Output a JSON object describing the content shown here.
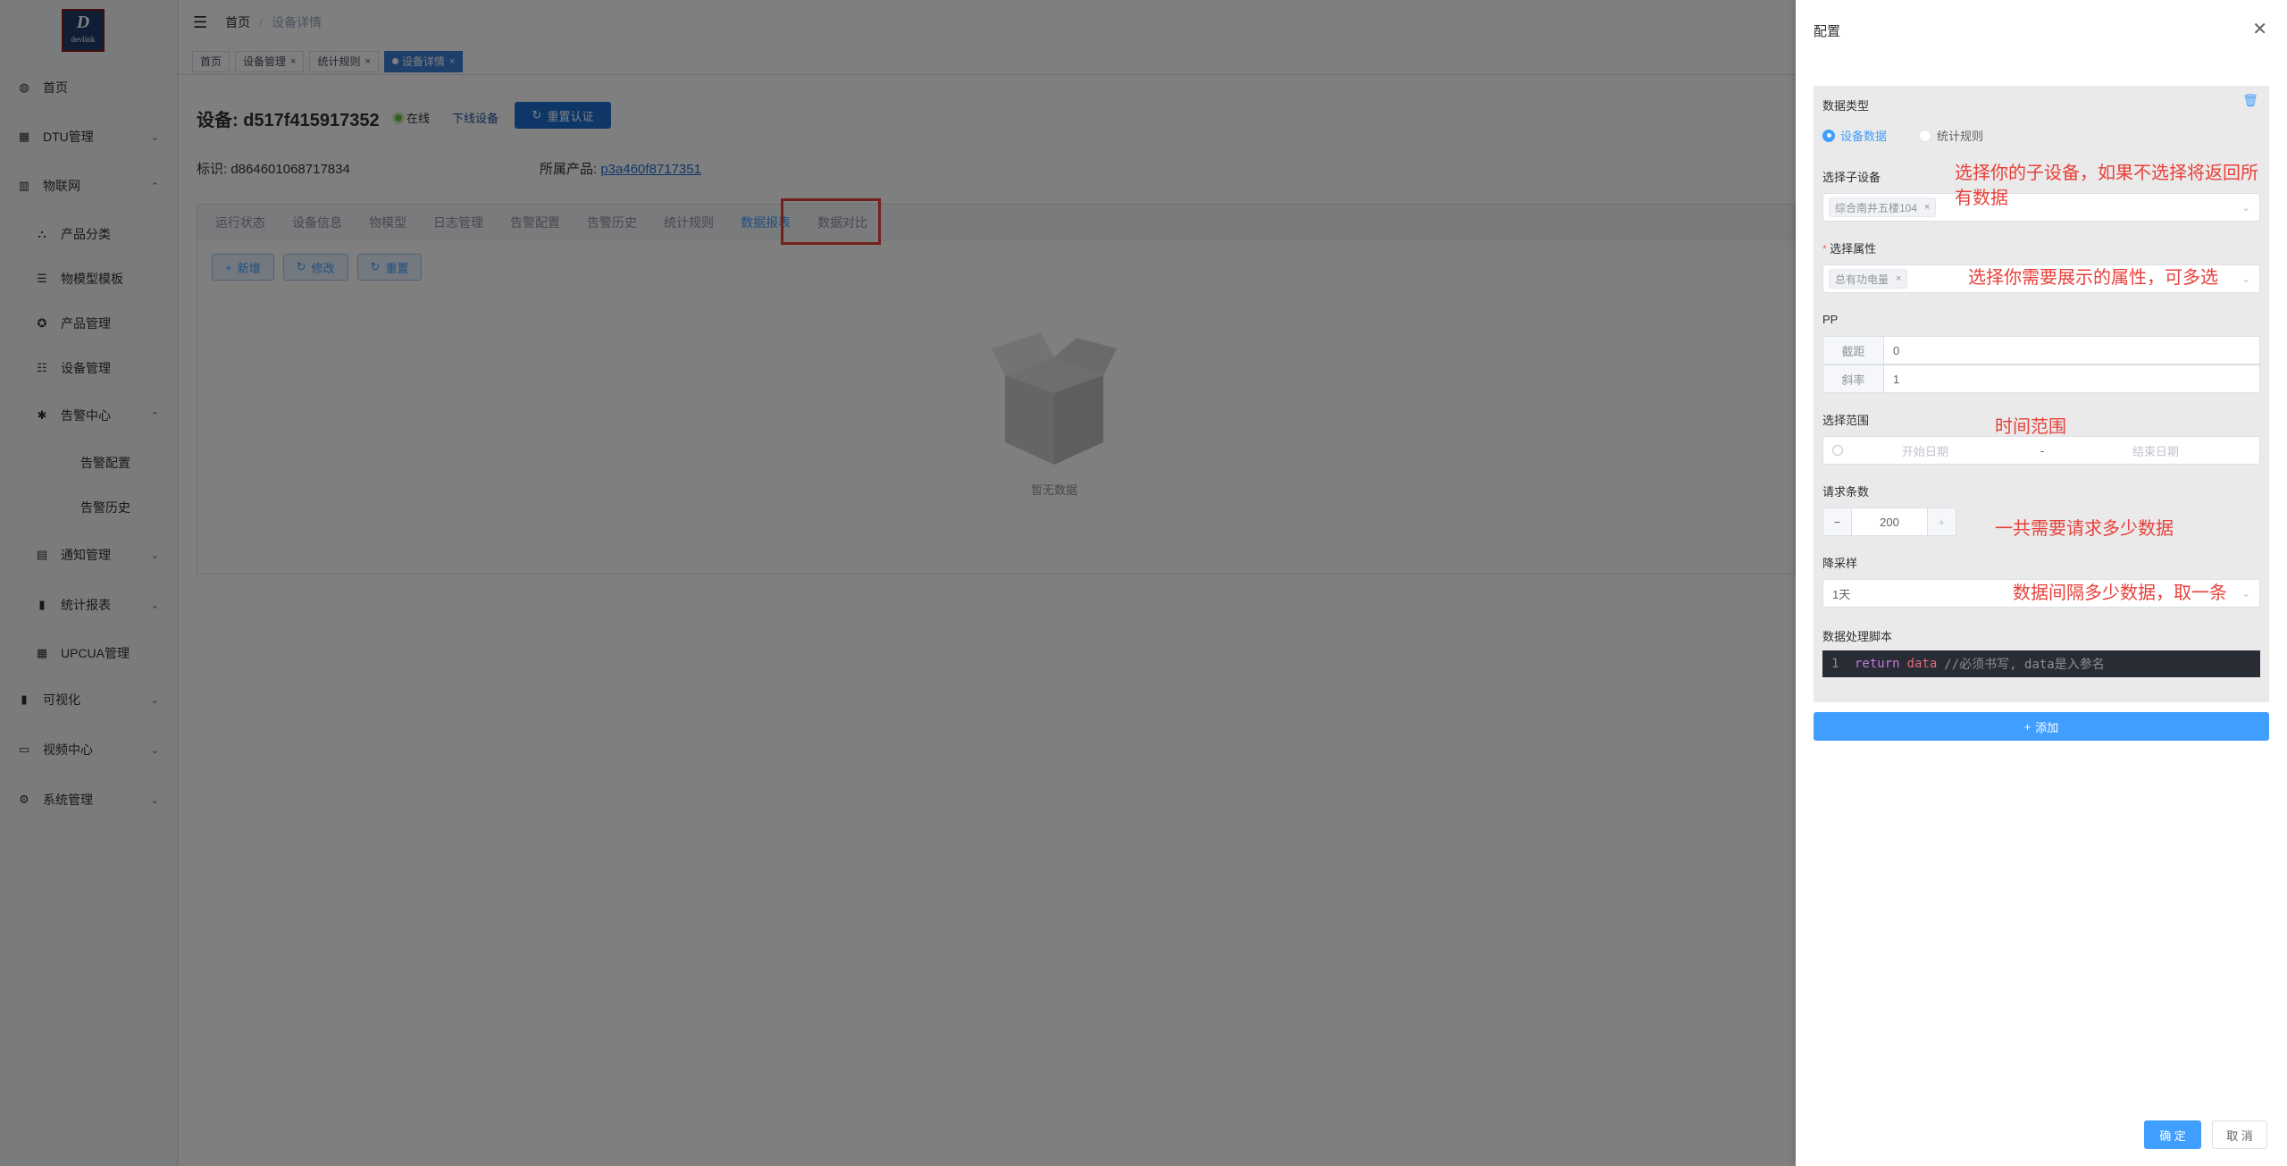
{
  "logo": {
    "letter": "D",
    "text": "devlink"
  },
  "sidebar": {
    "items": [
      {
        "label": "首页",
        "icon": "dashboard-icon",
        "arrow": ""
      },
      {
        "label": "DTU管理",
        "icon": "dtu-icon",
        "arrow": "⌄"
      },
      {
        "label": "物联网",
        "icon": "grid-icon",
        "arrow": "⌃"
      },
      {
        "label": "产品分类",
        "icon": "tree-icon",
        "arrow": ""
      },
      {
        "label": "物模型模板",
        "icon": "list-icon",
        "arrow": ""
      },
      {
        "label": "产品管理",
        "icon": "product-icon",
        "arrow": ""
      },
      {
        "label": "设备管理",
        "icon": "sliders-icon",
        "arrow": ""
      },
      {
        "label": "告警中心",
        "icon": "bug-icon",
        "arrow": "⌃"
      },
      {
        "label": "告警配置",
        "icon": "",
        "arrow": ""
      },
      {
        "label": "告警历史",
        "icon": "",
        "arrow": ""
      },
      {
        "label": "通知管理",
        "icon": "message-icon",
        "arrow": "⌄"
      },
      {
        "label": "统计报表",
        "icon": "chart-icon",
        "arrow": "⌄"
      },
      {
        "label": "UPCUA管理",
        "icon": "dtu-icon",
        "arrow": ""
      },
      {
        "label": "可视化",
        "icon": "chart-icon",
        "arrow": "⌄"
      },
      {
        "label": "视频中心",
        "icon": "monitor-icon",
        "arrow": "⌄"
      },
      {
        "label": "系统管理",
        "icon": "gear-icon",
        "arrow": "⌄"
      }
    ]
  },
  "header": {
    "home": "首页",
    "sep": "/",
    "current": "设备详情"
  },
  "tags": [
    {
      "label": "首页",
      "closable": false,
      "active": false
    },
    {
      "label": "设备管理",
      "closable": true,
      "active": false
    },
    {
      "label": "统计规则",
      "closable": true,
      "active": false
    },
    {
      "label": "设备详情",
      "closable": true,
      "active": true
    }
  ],
  "device": {
    "title": "设备: d517f415917352",
    "status": "在线",
    "offline_link": "下线设备",
    "auth_button": "重置认证",
    "id_label": "标识: d864601068717834",
    "product_label": "所属产品: ",
    "product_link": "p3a460f8717351"
  },
  "tabs": [
    "运行状态",
    "设备信息",
    "物模型",
    "日志管理",
    "告警配置",
    "告警历史",
    "统计规则",
    "数据报表",
    "数据对比"
  ],
  "active_tab": 7,
  "actions": {
    "add": "新增",
    "edit": "修改",
    "reset": "重置"
  },
  "empty_text": "暂无数据",
  "drawer": {
    "title": "配置",
    "data_type_label": "数据类型",
    "radio_device": "设备数据",
    "radio_rule": "统计规则",
    "subdevice_label": "选择子设备",
    "subdevice_chip": "综合南井五楼104",
    "attr_label": "选择属性",
    "attr_chip": "总有功电量",
    "pp_label": "PP",
    "intercept_label": "截距",
    "intercept_value": "0",
    "slope_label": "斜率",
    "slope_value": "1",
    "range_label": "选择范围",
    "range_start": "开始日期",
    "range_sep": "-",
    "range_end": "结束日期",
    "count_label": "请求条数",
    "count_value": "200",
    "downsample_label": "降采样",
    "downsample_value": "1天",
    "script_label": "数据处理脚本",
    "code_line": "1",
    "code_kw": "return",
    "code_var": "data",
    "code_comment": "//必须书写, data是入参名",
    "add_button": "添加",
    "ok_button": "确 定",
    "cancel_button": "取 消"
  },
  "annotations": {
    "subdevice": "选择你的子设备，如果不选择将返回所有数据",
    "attr": "选择你需要展示的属性，可多选",
    "range": "时间范围",
    "count": "一共需要请求多少数据",
    "downsample": "数据间隔多少数据，取一条"
  },
  "colors": {
    "primary": "#409eff",
    "annotation": "#e8403a",
    "code_bg": "#282c34"
  }
}
